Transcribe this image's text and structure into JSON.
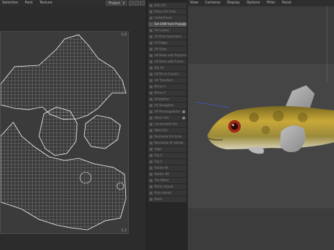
{
  "uv_editor": {
    "menu": [
      "Selection",
      "Pack",
      "Texture"
    ],
    "project_dropdown": "Project",
    "corner_labels": {
      "top_right": "1,0",
      "bottom_right": "1,1"
    }
  },
  "tool_panel": {
    "items": [
      {
        "label": "Edit UVs",
        "active": false
      },
      {
        "label": "Relax UVs Area",
        "active": false
      },
      {
        "label": "Unfold Faces",
        "active": false
      },
      {
        "label": "Set UVW from Projection",
        "active": true
      },
      {
        "label": "UV Layout",
        "active": false
      },
      {
        "label": "UV Paint Symmetry",
        "active": false
      },
      {
        "label": "UV Edges",
        "active": false
      },
      {
        "label": "UV Snap",
        "active": false
      },
      {
        "label": "UV Relax with Projection",
        "active": false
      },
      {
        "label": "UV Relax with Frame",
        "active": false
      },
      {
        "label": "Rig UV",
        "active": false
      },
      {
        "label": "UV Pin to Corners",
        "active": false
      },
      {
        "label": "UV Transform",
        "active": false
      },
      {
        "label": "Mirror U",
        "active": false
      },
      {
        "label": "Mirror V",
        "active": false
      },
      {
        "label": "Straighten",
        "active": false
      },
      {
        "label": "UV Straighten",
        "active": false
      },
      {
        "label": "UV Rectangularize",
        "active": false
      },
      {
        "label": "Stitch UVs",
        "active": false
      },
      {
        "label": "Constrained UVs",
        "active": false
      },
      {
        "label": "Weld UVs",
        "active": false
      },
      {
        "label": "Normalize UV Scale",
        "active": false
      },
      {
        "label": "Normalize All Islands",
        "active": false
      },
      {
        "label": "Align",
        "active": false
      },
      {
        "label": "Flip U",
        "active": false
      },
      {
        "label": "Flip V",
        "active": false
      },
      {
        "label": "Rotate 90",
        "active": false
      },
      {
        "label": "Rotate -90",
        "active": false
      },
      {
        "label": "Tile Offset",
        "active": false
      },
      {
        "label": "Mirror Islands",
        "active": false
      },
      {
        "label": "Pack Islands",
        "active": false
      },
      {
        "label": "Reset",
        "active": false
      }
    ]
  },
  "viewport": {
    "menu": [
      "View",
      "Cameras",
      "Display",
      "Options",
      "Filter",
      "Panel"
    ]
  },
  "colors": {
    "accent": "#e0b040",
    "fish_body": "#b89a2e",
    "fish_belly": "#d8d4bf",
    "eye": "#a02818",
    "wireframe": "#ffffff"
  }
}
